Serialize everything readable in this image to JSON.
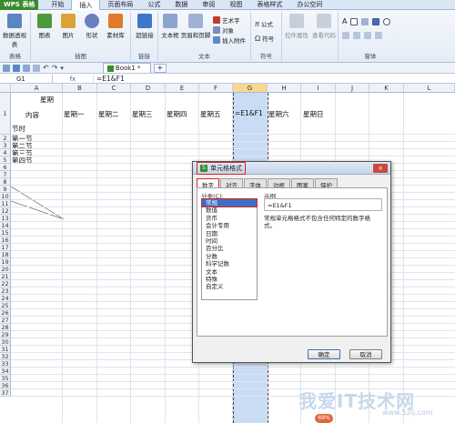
{
  "app": {
    "logo": "WPS 表格",
    "menu_tabs": [
      "开始",
      "插入",
      "页面布局",
      "公式",
      "数据",
      "审阅",
      "视图",
      "表格样式",
      "办公空间"
    ],
    "active_tab_index": 1
  },
  "ribbon": {
    "groups": [
      {
        "label": "表格",
        "buttons": [
          "数据透视表"
        ]
      },
      {
        "label": "插图",
        "buttons": [
          "图表",
          "图片",
          "形状",
          "素材库"
        ]
      },
      {
        "label": "链接",
        "buttons": [
          "超链接"
        ]
      },
      {
        "label": "文本",
        "buttons": [
          "文本框",
          "页眉和页脚"
        ],
        "small": [
          "艺术字",
          "对象",
          "插入附件"
        ]
      },
      {
        "label": "符号",
        "small": [
          "公式",
          "符号"
        ]
      },
      {
        "label": "",
        "buttons": [
          "控件属性",
          "查看代码"
        ]
      },
      {
        "label": "窗体",
        "buttons": []
      }
    ]
  },
  "workbook": {
    "tab_name": "Book1 *",
    "add_tab": "+"
  },
  "formula": {
    "namebox": "G1",
    "fx": "fx",
    "value": "=E1&F1"
  },
  "sheet": {
    "columns": [
      "A",
      "B",
      "C",
      "D",
      "E",
      "F",
      "G",
      "H",
      "I",
      "J",
      "K",
      "L"
    ],
    "selected_column": "G",
    "rows": [
      "1",
      "2",
      "3",
      "4",
      "5",
      "6",
      "7",
      "8",
      "9",
      "10",
      "11",
      "12",
      "13",
      "14",
      "15",
      "16",
      "17",
      "18",
      "19",
      "20",
      "21",
      "22",
      "23",
      "24",
      "25",
      "26",
      "27",
      "28",
      "29",
      "30",
      "31",
      "32",
      "33",
      "34",
      "35",
      "36",
      "37"
    ],
    "a1_top": "星期",
    "a1_mid": "内容",
    "a1_bottom": "节时",
    "header_cells": [
      "星期一",
      "星期二",
      "星期三",
      "星期四",
      "星期五",
      "=E1&F1",
      "星期六",
      "星期日"
    ],
    "row_labels": [
      "第一节",
      "第二节",
      "第三节",
      "第四节"
    ]
  },
  "dialog": {
    "title": "单元格格式",
    "close": "×",
    "tabs": [
      "数字",
      "对齐",
      "字体",
      "边框",
      "图案",
      "保护"
    ],
    "active_tab": 0,
    "category_label": "分类(C):",
    "categories": [
      "常规",
      "数值",
      "货币",
      "会计专用",
      "日期",
      "时间",
      "百分比",
      "分数",
      "科学记数",
      "文本",
      "特殊",
      "自定义"
    ],
    "selected_category": 0,
    "sample_label": "示例",
    "sample_value": "=E1&F1",
    "description": "常规单元格格式不包含任何特定的数字格式。",
    "ok": "确定",
    "cancel": "取消"
  },
  "watermark": {
    "text": "我爱IT技术网",
    "url": "www.52ij.com",
    "badge": "69%"
  }
}
